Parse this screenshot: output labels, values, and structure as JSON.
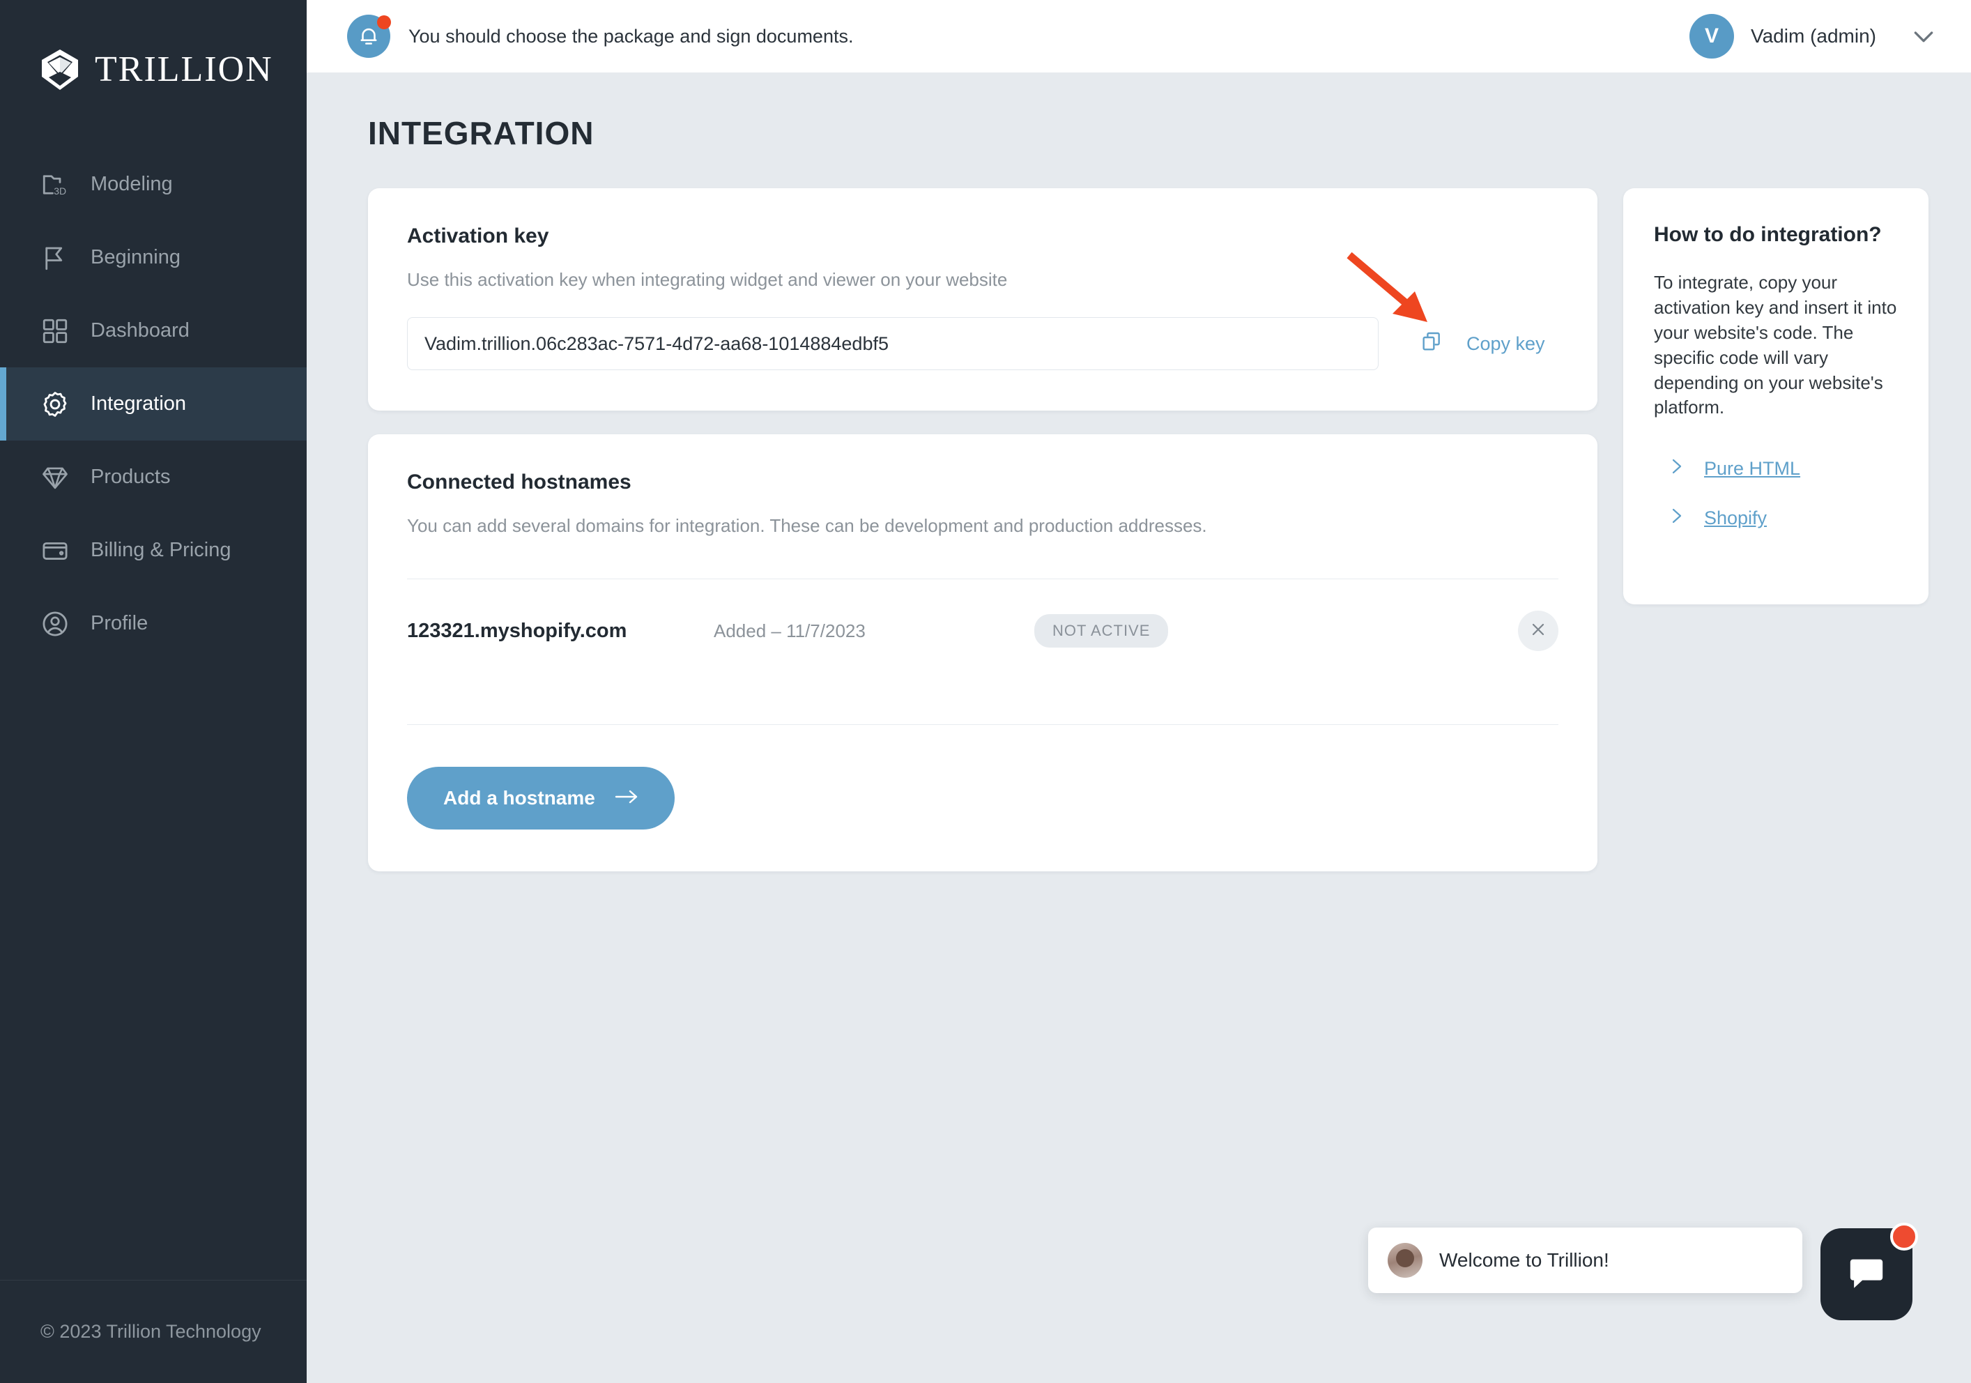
{
  "brand": {
    "name": "TRILLION",
    "logo_icon": "trillion-diamond-logo"
  },
  "sidebar": {
    "items": [
      {
        "label": "Modeling",
        "icon": "folder-3d-icon",
        "active": false
      },
      {
        "label": "Beginning",
        "icon": "flag-icon",
        "active": false
      },
      {
        "label": "Dashboard",
        "icon": "grid-icon",
        "active": false
      },
      {
        "label": "Integration",
        "icon": "gear-icon",
        "active": true
      },
      {
        "label": "Products",
        "icon": "diamond-icon",
        "active": false
      },
      {
        "label": "Billing & Pricing",
        "icon": "wallet-icon",
        "active": false
      },
      {
        "label": "Profile",
        "icon": "user-circle-icon",
        "active": false
      }
    ],
    "footer": "© 2023 Trillion Technology"
  },
  "topbar": {
    "notification": "You should choose the package and sign documents.",
    "notification_icon": "bell-icon",
    "user": {
      "initial": "V",
      "name": "Vadim (admin)",
      "chevron_icon": "chevron-down-icon"
    }
  },
  "page": {
    "title": "INTEGRATION"
  },
  "activation_card": {
    "title": "Activation key",
    "subtitle": "Use this activation key when integrating widget and viewer on your website",
    "key_value": "Vadim.trillion.06c283ac-7571-4d72-aa68-1014884edbf5",
    "key_placeholder": "Activation key",
    "copy_label": "Copy key",
    "copy_icon": "copy-icon"
  },
  "hostnames_card": {
    "title": "Connected hostnames",
    "subtitle": "You can add several domains for integration. These can be development and production addresses.",
    "rows": [
      {
        "hostname": "123321.myshopify.com",
        "added": "Added – 11/7/2023",
        "status": "NOT ACTIVE",
        "remove_icon": "close-icon"
      }
    ],
    "add_button": "Add a hostname",
    "add_button_icon": "arrow-right-icon"
  },
  "help_card": {
    "title": "How to do integration?",
    "body": "To integrate, copy your activation key and insert it into your website's code. The specific code will vary depending on your website's platform.",
    "links": [
      {
        "label": "Pure HTML",
        "icon": "chevron-right-icon"
      },
      {
        "label": "Shopify",
        "icon": "chevron-right-icon"
      }
    ]
  },
  "chat": {
    "message": "Welcome to Trillion!",
    "avatar_icon": "agent-avatar",
    "launcher_icon": "chat-bubble-icon",
    "unread_badge": ""
  },
  "annotation": {
    "arrow_color": "#ee4620"
  },
  "colors": {
    "accent": "#5fa0ca",
    "sidebar_bg": "#232c36",
    "sidebar_active_bg": "#2c3b49",
    "page_bg": "#e6eaee",
    "alert_red": "#ee4620"
  }
}
